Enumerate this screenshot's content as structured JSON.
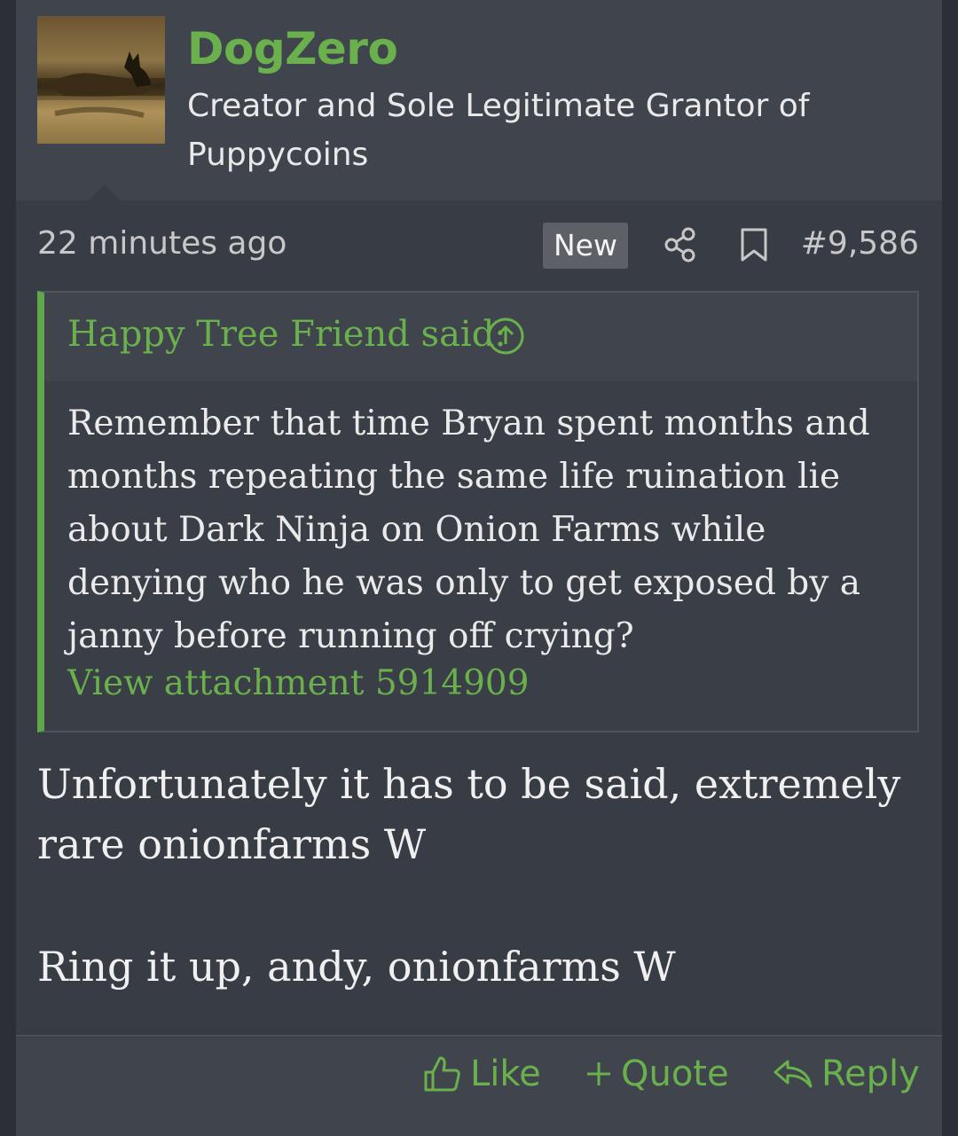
{
  "user": {
    "name": "DogZero",
    "title": "Creator and Sole Legitimate Grantor of Puppycoins"
  },
  "meta": {
    "time": "22 minutes ago",
    "badge": "New",
    "post_number": "#9,586"
  },
  "quote": {
    "author": "Happy Tree Friend said:",
    "body": "Remember that time Bryan spent months and months repeating the same life ruination lie about Dark Ninja on Onion Farms while denying who he was only to get exposed by a janny before running off crying?",
    "attachment": "View attachment 5914909"
  },
  "message": {
    "line1": "Unfortunately it has to be said, extremely rare onionfarms W",
    "line2": "Ring it up, andy, onionfarms W"
  },
  "actions": {
    "like": "Like",
    "quote": "Quote",
    "reply": "Reply"
  },
  "colors": {
    "accent": "#6ab04c",
    "background": "#383c44",
    "header": "#40454d"
  }
}
